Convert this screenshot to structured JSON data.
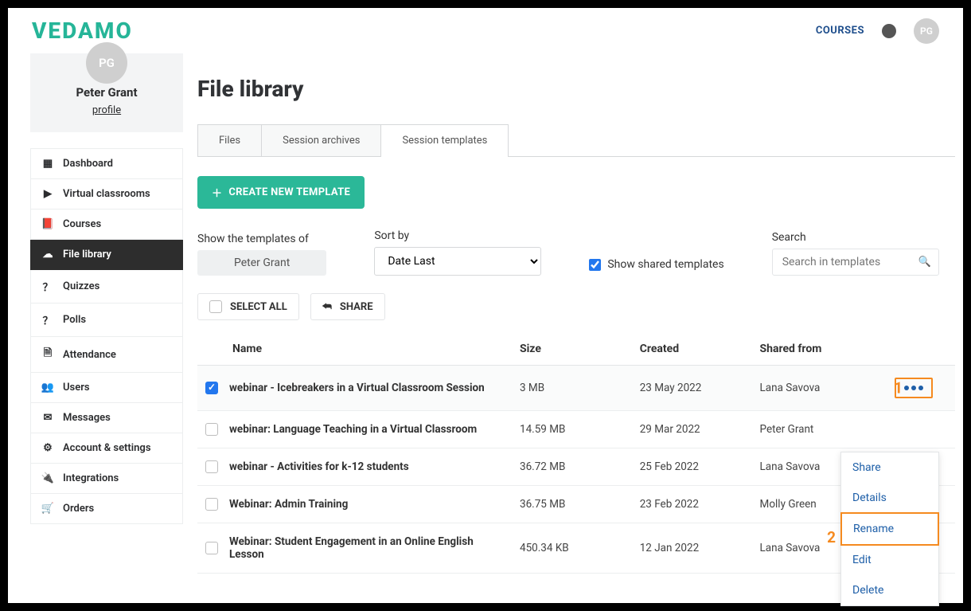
{
  "brand": "VEDAMO",
  "top_nav": {
    "courses": "COURSES",
    "avatar_initials": "PG"
  },
  "profile": {
    "avatar_initials": "PG",
    "name": "Peter Grant",
    "profile_link": "profile"
  },
  "sidebar": {
    "items": [
      {
        "label": "Dashboard",
        "icon": "▦",
        "active": false
      },
      {
        "label": "Virtual classrooms",
        "icon": "▶",
        "active": false
      },
      {
        "label": "Courses",
        "icon": "📕",
        "active": false
      },
      {
        "label": "File library",
        "icon": "☁",
        "active": true
      },
      {
        "label": "Quizzes",
        "icon": "？",
        "active": false
      },
      {
        "label": "Polls",
        "icon": "？",
        "active": false
      },
      {
        "label": "Attendance",
        "icon": "🗎",
        "active": false
      },
      {
        "label": "Users",
        "icon": "👥",
        "active": false
      },
      {
        "label": "Messages",
        "icon": "✉",
        "active": false
      },
      {
        "label": "Account & settings",
        "icon": "⚙",
        "active": false
      },
      {
        "label": "Integrations",
        "icon": "🔌",
        "active": false
      },
      {
        "label": "Orders",
        "icon": "🛒",
        "active": false
      }
    ]
  },
  "page": {
    "title": "File library"
  },
  "tabs": [
    {
      "label": "Files",
      "active": false
    },
    {
      "label": "Session archives",
      "active": false
    },
    {
      "label": "Session templates",
      "active": true
    }
  ],
  "buttons": {
    "create_template": "CREATE NEW TEMPLATE"
  },
  "filters": {
    "owner_label": "Show the templates of",
    "owner_value": "Peter Grant",
    "sort_label": "Sort by",
    "sort_value": "Date Last",
    "shared_checkbox_label": "Show shared templates",
    "shared_checked": true,
    "search_label": "Search",
    "search_placeholder": "Search in templates"
  },
  "toolbar": {
    "select_all": "SELECT ALL",
    "share": "SHARE"
  },
  "columns": {
    "name": "Name",
    "size": "Size",
    "created": "Created",
    "shared_from": "Shared from"
  },
  "rows": [
    {
      "checked": true,
      "name": "webinar - Icebreakers in a Virtual Classroom Session",
      "size": "3 MB",
      "created": "23 May 2022",
      "shared_from": "Lana Savova"
    },
    {
      "checked": false,
      "name": "webinar: Language Teaching in a Virtual Classroom",
      "size": "14.59 MB",
      "created": "29 Mar 2022",
      "shared_from": "Peter Grant"
    },
    {
      "checked": false,
      "name": "webinar - Activities for k-12 students",
      "size": "36.72 MB",
      "created": "25 Feb 2022",
      "shared_from": "Lana Savova"
    },
    {
      "checked": false,
      "name": "Webinar: Admin Training",
      "size": "36.75 MB",
      "created": "23 Feb 2022",
      "shared_from": "Molly Green"
    },
    {
      "checked": false,
      "name": "Webinar: Student Engagement in an Online English Lesson",
      "size": "450.34 KB",
      "created": "12 Jan 2022",
      "shared_from": "Lana Savova"
    }
  ],
  "dropdown": {
    "items": [
      {
        "label": "Share"
      },
      {
        "label": "Details"
      },
      {
        "label": "Rename"
      },
      {
        "label": "Edit"
      },
      {
        "label": "Delete"
      }
    ],
    "highlight_index": 2
  },
  "annotations": {
    "one": "1",
    "two": "2"
  }
}
